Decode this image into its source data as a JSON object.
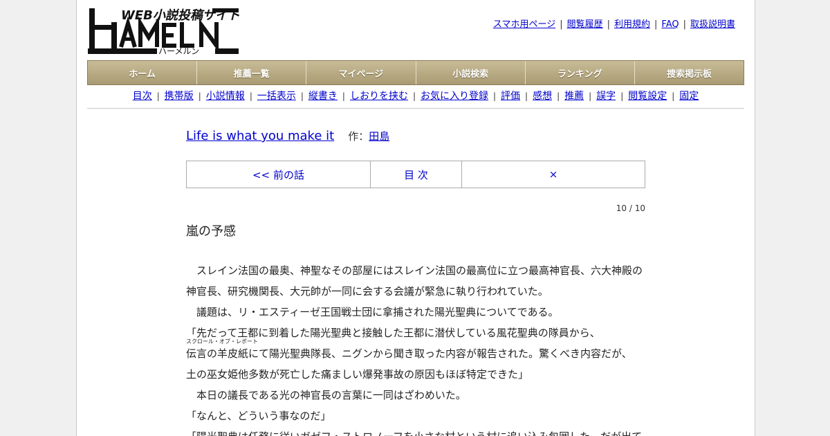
{
  "logo": {
    "text": "HAMELN",
    "tagline": "WEB小説投稿サイト",
    "kana": "ハーメルン"
  },
  "top_links": [
    "スマホ用ページ",
    "閲覧履歴",
    "利用規約",
    "FAQ",
    "取扱説明書"
  ],
  "top_links_separator": "|",
  "main_nav": [
    "ホーム",
    "推薦一覧",
    "マイページ",
    "小説検索",
    "ランキング",
    "捜索掲示板"
  ],
  "sub_nav": [
    "目次",
    "携帯版",
    "小説情報",
    "一括表示",
    "縦書き",
    "しおりを挟む",
    "お気に入り登録",
    "評価",
    "感想",
    "推薦",
    "誤字",
    "閲覧設定",
    "固定"
  ],
  "sub_nav_separator": "|",
  "novel": {
    "title": "Life is what you make it",
    "author_label": "作：",
    "author": "田島"
  },
  "episode_nav": {
    "prev": "<< 前の話",
    "toc": "目 次",
    "next": "×"
  },
  "page_count": "10 / 10",
  "chapter_title": "嵐の予感",
  "body": {
    "line1": "　スレイン法国の最奥、神聖なその部屋にはスレイン法国の最高位に立つ最高神官長、六大神殿の",
    "line2": "神官長、研究機関長、大元帥が一同に会する会議が緊急に執り行われていた。",
    "line3": "　議題は、リ・エスティーゼ王国戦士団に拿捕された陽光聖典についてである。",
    "line4": "「先だって王都に到着した陽光聖典と接触した王都に潜伏している風花聖典の隊員から、",
    "line5_ruby_base": "伝言の羊皮紙",
    "line5_ruby_text": "スクロール・オブ・レポート",
    "line5_rest": "にて陽光聖典隊長、ニグンから聞き取った内容が報告された。驚くべき内容だが、",
    "line6": "土の巫女姫他多数が死亡した痛ましい爆発事故の原因もほぼ特定できた」",
    "line7": "　本日の議長である光の神官長の言葉に一同はざわめいた。",
    "line8": "「なんと、どういう事なのだ」",
    "line9": "「陽光聖典は任務に従いガゼフ・ストロノーフを小さな村という村に追い込み包囲した。だが出て"
  },
  "colors": {
    "link": "#0000cc",
    "nav_bar": "#b4a780",
    "background": "#f0f0f0"
  }
}
